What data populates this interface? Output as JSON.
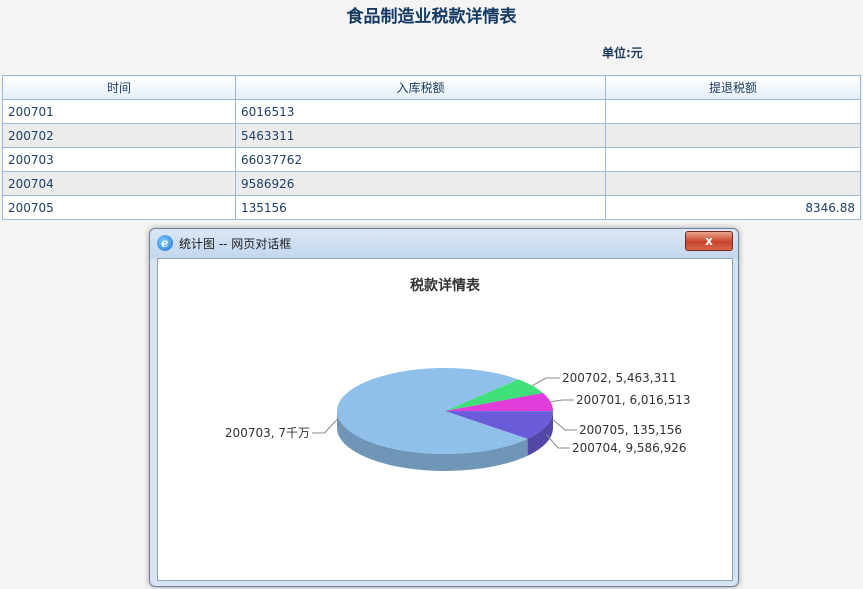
{
  "page": {
    "title": "食品制造业税款详情表",
    "unit": "单位:元"
  },
  "table": {
    "headers": [
      "时间",
      "入库税额",
      "提退税额"
    ],
    "rows": [
      [
        "200701",
        "6016513",
        ""
      ],
      [
        "200702",
        "5463311",
        ""
      ],
      [
        "200703",
        "66037762",
        ""
      ],
      [
        "200704",
        "9586926",
        ""
      ],
      [
        "200705",
        "135156",
        "8346.88"
      ]
    ]
  },
  "dialog": {
    "title": "统计图 -- 网页对话框",
    "icon": "ie-icon",
    "close_label": "x"
  },
  "chart_data": {
    "type": "pie",
    "title": "税款详情表",
    "slices": [
      {
        "label": "200703",
        "value": 66037762,
        "display": "200703, 7千万",
        "color": "#8fc0ea"
      },
      {
        "label": "200702",
        "value": 5463311,
        "display": "200702, 5,463,311",
        "color": "#3fe07a"
      },
      {
        "label": "200701",
        "value": 6016513,
        "display": "200701, 6,016,513",
        "color": "#e03ddb"
      },
      {
        "label": "200705",
        "value": 135156,
        "display": "200705, 135,156",
        "color": "#4a7de0"
      },
      {
        "label": "200704",
        "value": 9586926,
        "display": "200704, 9,586,926",
        "color": "#6a5cd8"
      }
    ]
  }
}
